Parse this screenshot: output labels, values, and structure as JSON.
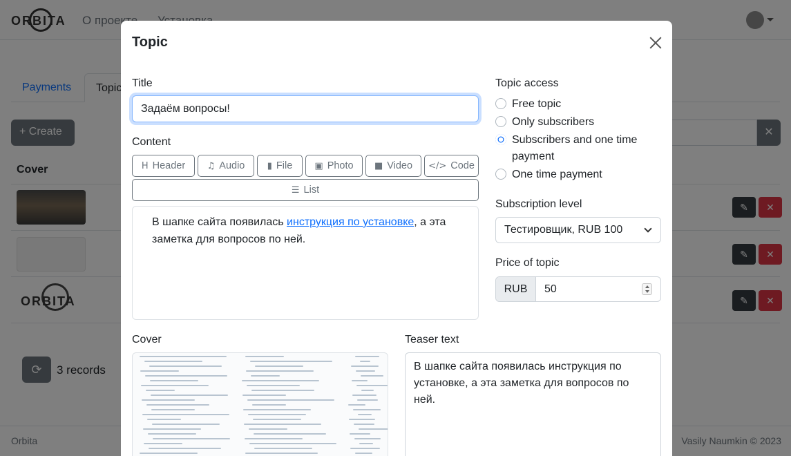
{
  "navbar": {
    "logo_text": "ORBITA",
    "links": [
      "О проекте",
      "Установка"
    ]
  },
  "tabs": [
    "Payments",
    "Topics"
  ],
  "toolbar": {
    "create_label": "+ Create",
    "clear_label": "✕"
  },
  "table": {
    "header_cover": "Cover"
  },
  "footer": {
    "records": "3 records",
    "left": "Orbita",
    "right": "Vasily Naumkin © 2023"
  },
  "modal": {
    "title": "Topic",
    "title_label": "Title",
    "title_value": "Задаём вопросы!",
    "content_label": "Content",
    "tools": [
      {
        "label": "Header",
        "icon": "H"
      },
      {
        "label": "Audio",
        "icon": "♫"
      },
      {
        "label": "File",
        "icon": "▮"
      },
      {
        "label": "Photo",
        "icon": "▣"
      },
      {
        "label": "Video",
        "icon": "■"
      },
      {
        "label": "Code",
        "icon": "</>"
      },
      {
        "label": "List",
        "icon": "☰"
      }
    ],
    "editor": {
      "text_before": "В шапке сайта появилась ",
      "link_text": "инструкция по установке",
      "text_after": ", а эта заметка для вопросов по ней."
    },
    "access_label": "Topic access",
    "access_options": [
      "Free topic",
      "Only subscribers",
      "Subscribers and one time payment",
      "One time payment"
    ],
    "access_selected": "Subscribers and one time payment",
    "subscription_label": "Subscription level",
    "subscription_value": "Тестировщик, RUB 100",
    "price_label": "Price of topic",
    "price_currency": "RUB",
    "price_value": "50",
    "cover_label": "Cover",
    "teaser_label": "Teaser text",
    "teaser_value": "В шапке сайта появилась инструкция по установке, а эта заметка для вопросов по ней."
  }
}
